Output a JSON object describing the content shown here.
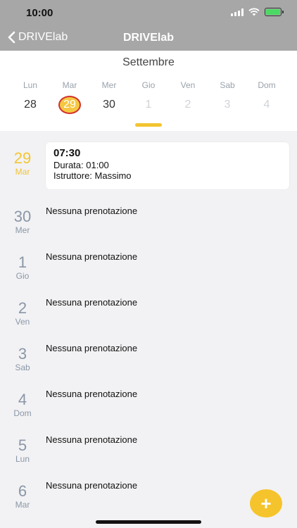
{
  "status": {
    "time": "10:00"
  },
  "nav": {
    "back_label": "DRIVElab",
    "title": "DRIVElab"
  },
  "calendar": {
    "month": "Settembre",
    "days": [
      {
        "name": "Lun",
        "num": "28"
      },
      {
        "name": "Mar",
        "num": "29"
      },
      {
        "name": "Mer",
        "num": "30"
      },
      {
        "name": "Gio",
        "num": "1"
      },
      {
        "name": "Ven",
        "num": "2"
      },
      {
        "name": "Sab",
        "num": "3"
      },
      {
        "name": "Dom",
        "num": "4"
      }
    ],
    "selected_index": 1
  },
  "agenda": [
    {
      "num": "29",
      "weekday": "Mar",
      "booking": {
        "time": "07:30",
        "duration": "Durata: 01:00",
        "instructor": "Istruttore: Massimo"
      }
    },
    {
      "num": "30",
      "weekday": "Mer",
      "empty": "Nessuna prenotazione"
    },
    {
      "num": "1",
      "weekday": "Gio",
      "empty": "Nessuna prenotazione"
    },
    {
      "num": "2",
      "weekday": "Ven",
      "empty": "Nessuna prenotazione"
    },
    {
      "num": "3",
      "weekday": "Sab",
      "empty": "Nessuna prenotazione"
    },
    {
      "num": "4",
      "weekday": "Dom",
      "empty": "Nessuna prenotazione"
    },
    {
      "num": "5",
      "weekday": "Lun",
      "empty": "Nessuna prenotazione"
    },
    {
      "num": "6",
      "weekday": "Mar",
      "empty": "Nessuna prenotazione"
    }
  ],
  "fab": {
    "label": "+"
  },
  "colors": {
    "accent": "#f2c530",
    "selected_ring": "#d3312c",
    "header": "#a7a7a7"
  }
}
